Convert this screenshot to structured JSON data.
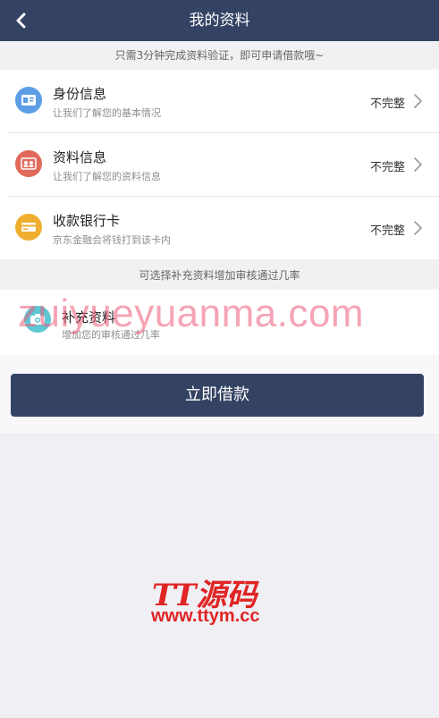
{
  "header": {
    "title": "我的资料",
    "back_icon": "chevron-left-icon"
  },
  "notice": "只需3分钟完成资料验证，即可申请借款哦~",
  "items": [
    {
      "title": "身份信息",
      "subtitle": "让我们了解您的基本情况",
      "status": "不完整",
      "icon": "id-card-icon",
      "color": "#5b9ee6"
    },
    {
      "title": "资料信息",
      "subtitle": "让我们了解您的资料信息",
      "status": "不完整",
      "icon": "contact-card-icon",
      "color": "#e1695a"
    },
    {
      "title": "收款银行卡",
      "subtitle": "京东金融会将钱打到该卡内",
      "status": "不完整",
      "icon": "bank-card-icon",
      "color": "#f0ae2e"
    }
  ],
  "section_hint": "可选择补充资料增加审核通过几率",
  "extra": {
    "title": "补充资料",
    "subtitle": "增加您的审核通过几率",
    "icon": "camera-icon",
    "color": "#5ec7d3"
  },
  "primary_button": "立即借款",
  "watermark_text": "zuiyueyuanma.com",
  "logo": {
    "name": "TT源码",
    "url": "www.ttym.cc"
  },
  "colors": {
    "primary": "#344364",
    "background": "#efeff4",
    "logo_red": "#e02424"
  }
}
